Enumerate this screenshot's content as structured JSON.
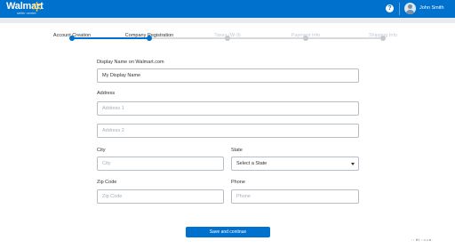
{
  "header": {
    "logo_text": "Walmart",
    "logo_subtext": "seller center",
    "help_icon": "help-icon",
    "user_name": "John Smith"
  },
  "steps": [
    {
      "label": "Account Creation",
      "state": "complete"
    },
    {
      "label": "Company Registration",
      "state": "current"
    },
    {
      "label": "Taxes (W-9)",
      "state": "upcoming"
    },
    {
      "label": "Payment Info",
      "state": "upcoming"
    },
    {
      "label": "Shipping Info",
      "state": "upcoming"
    }
  ],
  "form": {
    "display_name": {
      "label": "Display Name on Walmart.com",
      "value": "My Display Name"
    },
    "address": {
      "label": "Address",
      "line1_placeholder": "Address 1",
      "line2_placeholder": "Address 2"
    },
    "city": {
      "label": "City",
      "placeholder": "City"
    },
    "state": {
      "label": "State",
      "selected": "Select a State"
    },
    "zip": {
      "label": "Zip Code",
      "placeholder": "Zip Code"
    },
    "phone": {
      "label": "Phone",
      "placeholder": "Phone"
    }
  },
  "actions": {
    "save_label": "Save and continue"
  },
  "footer": {
    "corner_text": ":: lfi ::==n"
  },
  "colors": {
    "brand_blue": "#0072ce",
    "step_active": "#0072ce",
    "step_inactive": "#c4c9cf",
    "spark_yellow": "#ffc220"
  }
}
